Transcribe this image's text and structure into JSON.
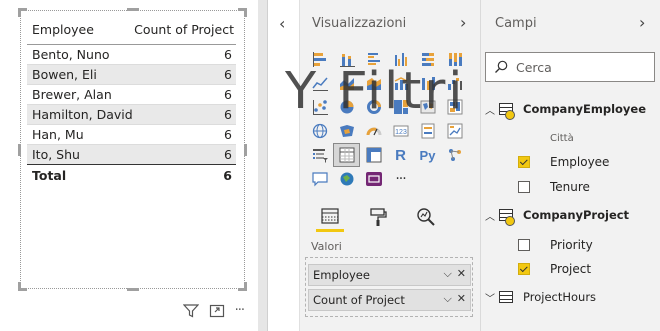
{
  "table": {
    "columns": [
      "Employee",
      "Count of Project"
    ],
    "rows": [
      {
        "employee": "Bento, Nuno",
        "count": "6"
      },
      {
        "employee": "Bowen, Eli",
        "count": "6"
      },
      {
        "employee": "Brewer, Alan",
        "count": "6"
      },
      {
        "employee": "Hamilton, David",
        "count": "6"
      },
      {
        "employee": "Han, Mu",
        "count": "6"
      },
      {
        "employee": "Ito, Shu",
        "count": "6"
      }
    ],
    "total_label": "Total",
    "total_value": "6"
  },
  "visual_toolbar": {
    "icons": [
      "filter-icon",
      "focus-mode-icon",
      "more-options-icon"
    ],
    "more_label": "···"
  },
  "visualizations": {
    "title": "Visualizzazioni",
    "more_label": "···",
    "tabs": [
      "fields-tab",
      "format-tab",
      "analytics-tab"
    ],
    "wells_label": "Valori",
    "wells": [
      "Employee",
      "Count of Project"
    ]
  },
  "overlay_title": "Y Filtri",
  "fields": {
    "title": "Campi",
    "search_placeholder": "Cerca",
    "tables": [
      {
        "name": "CompanyEmployee",
        "expanded": true,
        "items": [
          {
            "label": "Città",
            "checked": null
          },
          {
            "label": "Employee",
            "checked": true
          },
          {
            "label": "Tenure",
            "checked": false
          }
        ]
      },
      {
        "name": "CompanyProject",
        "expanded": true,
        "items": [
          {
            "label": "Priority",
            "checked": false
          },
          {
            "label": "Project",
            "checked": true
          }
        ]
      },
      {
        "name": "ProjectHours",
        "expanded": false,
        "items": []
      }
    ]
  },
  "colors": {
    "accent": "#f2c811",
    "pane_bg": "#f2f2f2",
    "row_alt": "#e9e9e9"
  }
}
